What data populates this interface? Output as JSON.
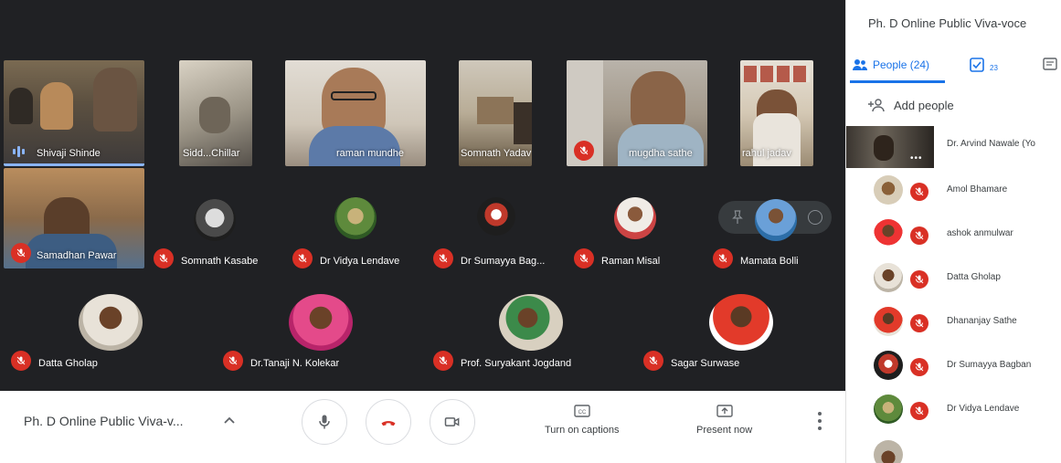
{
  "meeting": {
    "title": "Ph. D Online Public Viva-v...",
    "panel_title": "Ph. D Online Public Viva-voce"
  },
  "top_tiles": [
    {
      "name": "Shivaji Shinde"
    },
    {
      "name": "Sidd...Chillar"
    },
    {
      "name": "raman mundhe"
    },
    {
      "name": "Somnath Yadav"
    },
    {
      "name": "mugdha sathe"
    },
    {
      "name": "rahul jadav"
    }
  ],
  "grid_row1": [
    {
      "name": "Samadhan Pawar"
    },
    {
      "name": "Somnath Kasabe"
    },
    {
      "name": "Dr Vidya Lendave"
    },
    {
      "name": "Dr Sumayya Bag..."
    },
    {
      "name": "Raman Misal"
    },
    {
      "name": "Mamata Bolli"
    }
  ],
  "grid_row2": [
    {
      "name": "Datta Gholap"
    },
    {
      "name": "Dr.Tanaji N. Kolekar"
    },
    {
      "name": "Prof. Suryakant Jogdand"
    },
    {
      "name": "Sagar Surwase"
    }
  ],
  "controls": {
    "captions_label": "Turn on captions",
    "present_label": "Present now"
  },
  "panel": {
    "people_tab": "People (24)",
    "tasks_count": "23",
    "add_people": "Add people",
    "people": [
      {
        "name": "Dr. Arvind Nawale (Yo"
      },
      {
        "name": "Amol Bhamare"
      },
      {
        "name": "ashok anmulwar"
      },
      {
        "name": "Datta Gholap"
      },
      {
        "name": "Dhananjay Sathe"
      },
      {
        "name": "Dr Sumayya Bagban"
      },
      {
        "name": "Dr Vidya Lendave"
      }
    ]
  },
  "colors": {
    "stage_bg": "#202124",
    "accent": "#1a73e8",
    "mic_off": "#d93025",
    "hangup": "#d93025"
  }
}
